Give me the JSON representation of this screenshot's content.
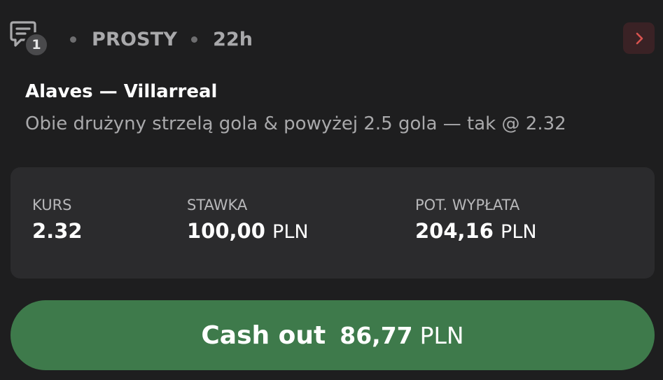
{
  "header": {
    "comment_count": "1",
    "bet_type": "PROSTY",
    "time_ago": "22h",
    "icons": {
      "comments": "chat-bubble-icon",
      "next": "chevron-right-icon"
    }
  },
  "bet": {
    "match": "Alaves — Villarreal",
    "selection": "Obie drużyny strzelą gola & powyżej 2.5 gola — tak @ 2.32"
  },
  "stats": {
    "odds_label": "KURS",
    "odds_value": "2.32",
    "stake_label": "STAWKA",
    "stake_value": "100,00",
    "stake_currency": "PLN",
    "payout_label": "POT. WYPŁATA",
    "payout_value": "204,16",
    "payout_currency": "PLN"
  },
  "cashout": {
    "label": "Cash out",
    "amount": "86,77",
    "currency": "PLN"
  },
  "colors": {
    "background": "#1e1e1f",
    "card": "#2b2b2d",
    "cashout_button": "#3e7a4b",
    "arrow_button_bg": "#3a2225",
    "arrow_color": "#d9534f",
    "muted_text": "#a9a9ab"
  }
}
